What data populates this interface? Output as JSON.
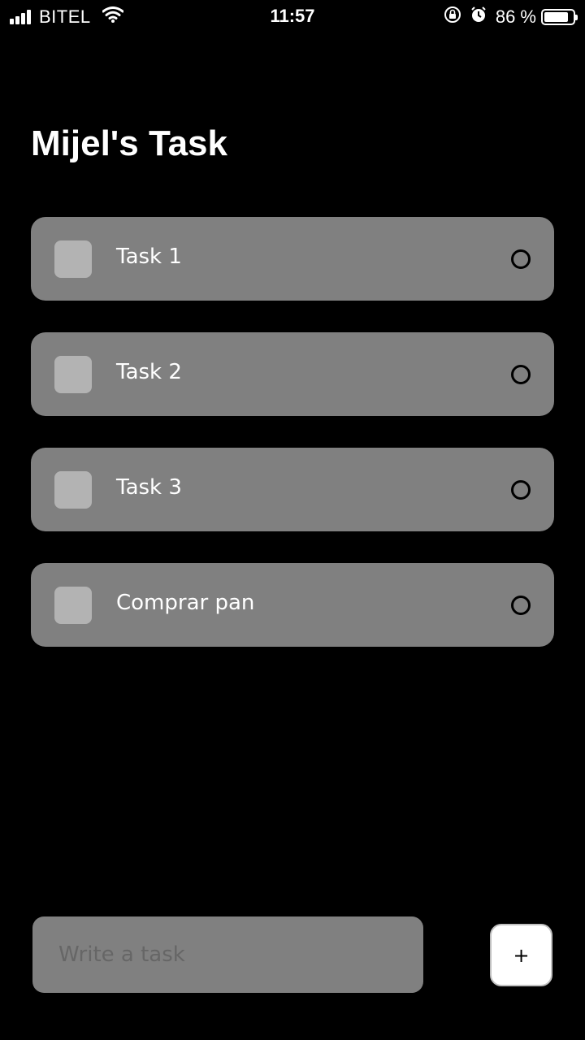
{
  "status_bar": {
    "carrier": "BITEL",
    "time": "11:57",
    "battery_text": "86 %",
    "battery_level": 0.86
  },
  "header": {
    "title": "Mijel's Task"
  },
  "tasks": [
    {
      "label": "Task 1"
    },
    {
      "label": "Task 2"
    },
    {
      "label": "Task 3"
    },
    {
      "label": "Comprar pan"
    }
  ],
  "composer": {
    "placeholder": "Write a task",
    "value": "",
    "add_label": "+"
  },
  "colors": {
    "background": "#000000",
    "card": "#808080",
    "checkbox": "#b3b3b3",
    "text": "#ffffff"
  }
}
